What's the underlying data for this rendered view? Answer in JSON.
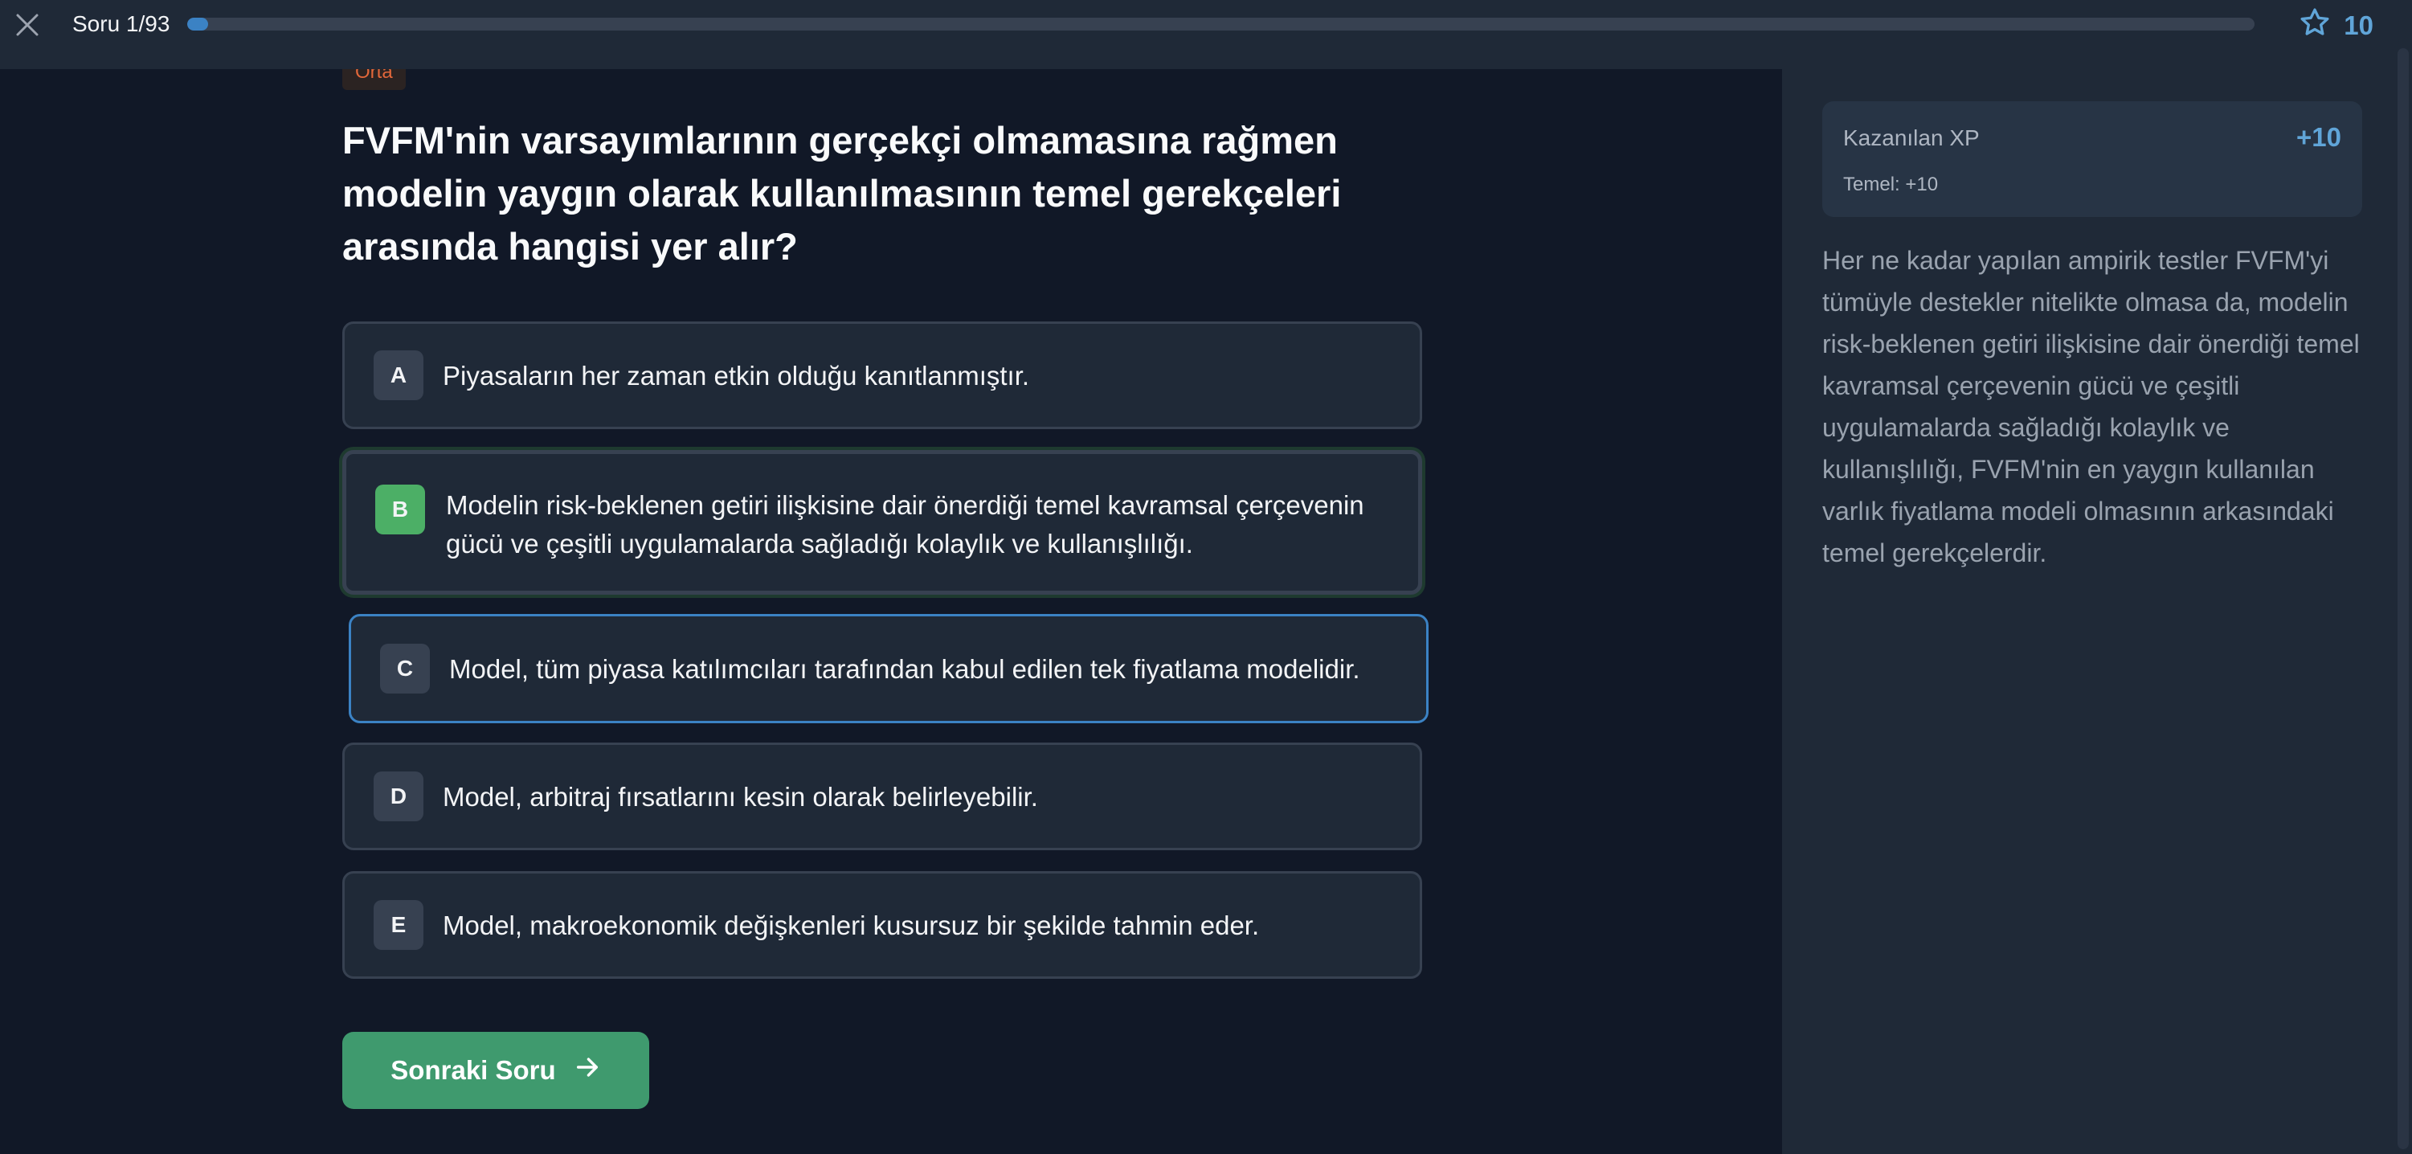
{
  "header": {
    "progress_label": "Soru 1/93",
    "progress_fraction": 0.01,
    "score": "10",
    "close_icon": "close-icon",
    "star_icon": "star-icon"
  },
  "question": {
    "difficulty": "Orta",
    "text": "FVFM'nin varsayımlarının gerçekçi olmamasına rağmen modelin yaygın olarak kullanılmasının temel gerekçeleri arasında hangisi yer alır?",
    "options": [
      {
        "letter": "A",
        "text": "Piyasaların her zaman etkin olduğu kanıtlanmıştır."
      },
      {
        "letter": "B",
        "text": "Modelin risk-beklenen getiri ilişkisine dair önerdiği temel kavramsal çerçevenin gücü ve çeşitli uygulamalarda sağladığı kolaylık ve kullanışlılığı."
      },
      {
        "letter": "C",
        "text": "Model, tüm piyasa katılımcıları tarafından kabul edilen tek fiyatlama modelidir."
      },
      {
        "letter": "D",
        "text": "Model, arbitraj fırsatlarını kesin olarak belirleyebilir."
      },
      {
        "letter": "E",
        "text": "Model, makroekonomik değişkenleri kusursuz bir şekilde tahmin eder."
      }
    ],
    "correct_color": "#4caf66",
    "selected_color": "#3b82c4"
  },
  "next_button": {
    "label": "Sonraki Soru",
    "icon": "arrow-right-icon",
    "color": "#3f9a6e"
  },
  "sidebar": {
    "xp_title": "Kazanılan XP",
    "xp_value": "+10",
    "xp_sub": "Temel: +10",
    "explanation": "Her ne kadar yapılan ampirik testler FVFM'yi tümüyle destekler nitelikte olmasa da, modelin risk-beklenen getiri ilişkisine dair önerdiği temel kavramsal çerçevenin gücü ve çeşitli uygulamalarda sağladığı kolaylık ve kullanışlılığı, FVFM'nin en yaygın kullanılan varlık fiyatlama modeli olmasının arkasındaki temel gerekçelerdir."
  }
}
